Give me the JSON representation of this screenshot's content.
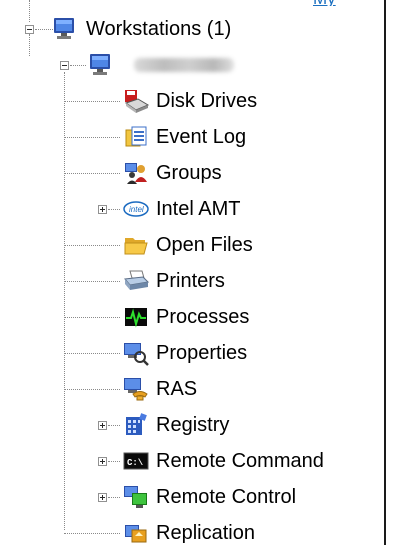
{
  "top_link": {
    "text": "My"
  },
  "tree": {
    "root": {
      "label": "Workstations (1)",
      "icon": "monitor-icon",
      "expanded": true
    },
    "computer": {
      "label": "",
      "icon": "monitor-icon",
      "expanded": true,
      "name_obscured": true
    },
    "items": [
      {
        "label": "Disk Drives",
        "icon": "disk-drive-icon",
        "expandable": false
      },
      {
        "label": "Event Log",
        "icon": "event-log-icon",
        "expandable": false
      },
      {
        "label": "Groups",
        "icon": "groups-icon",
        "expandable": false
      },
      {
        "label": "Intel AMT",
        "icon": "intel-icon",
        "expandable": true
      },
      {
        "label": "Open Files",
        "icon": "folder-open-icon",
        "expandable": false
      },
      {
        "label": "Printers",
        "icon": "printer-icon",
        "expandable": false
      },
      {
        "label": "Processes",
        "icon": "processes-icon",
        "expandable": false
      },
      {
        "label": "Properties",
        "icon": "properties-icon",
        "expandable": false
      },
      {
        "label": "RAS",
        "icon": "ras-icon",
        "expandable": false
      },
      {
        "label": "Registry",
        "icon": "registry-icon",
        "expandable": true
      },
      {
        "label": "Remote Command",
        "icon": "command-prompt-icon",
        "expandable": true
      },
      {
        "label": "Remote Control",
        "icon": "remote-control-icon",
        "expandable": true
      },
      {
        "label": "Replication",
        "icon": "replication-icon",
        "expandable": false
      }
    ]
  }
}
